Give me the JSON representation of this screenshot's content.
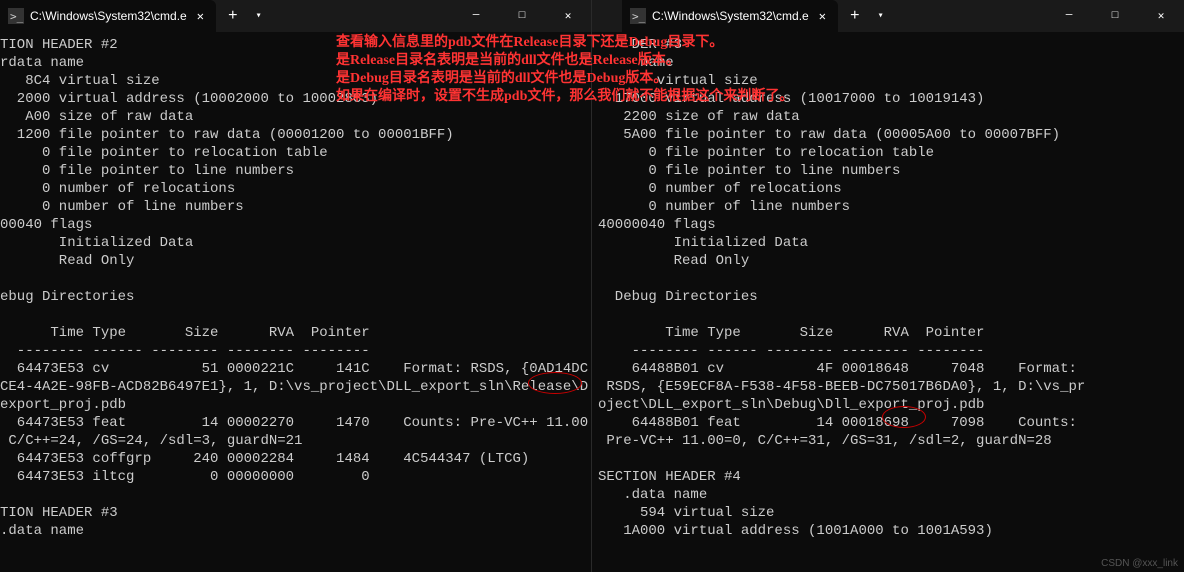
{
  "left": {
    "tab_title": "C:\\Windows\\System32\\cmd.e",
    "terminal": "TION HEADER #2\nrdata name\n   8C4 virtual size\n  2000 virtual address (10002000 to 100028C3)\n   A00 size of raw data\n  1200 file pointer to raw data (00001200 to 00001BFF)\n     0 file pointer to relocation table\n     0 file pointer to line numbers\n     0 number of relocations\n     0 number of line numbers\n00040 flags\n       Initialized Data\n       Read Only\n\nebug Directories\n\n      Time Type       Size      RVA  Pointer\n  -------- ------ -------- -------- --------\n  64473E53 cv           51 0000221C     141C    Format: RSDS, {0AD14DC\nCE4-4A2E-98FB-ACD82B6497E1}, 1, D:\\vs_project\\DLL_export_sln\\Release\\D\nexport_proj.pdb\n  64473E53 feat         14 00002270     1470    Counts: Pre-VC++ 11.00\n C/C++=24, /GS=24, /sdl=3, guardN=21\n  64473E53 coffgrp     240 00002284     1484    4C544347 (LTCG)\n  64473E53 iltcg         0 00000000        0\n\nTION HEADER #3\n.data name"
  },
  "right": {
    "tab_title": "C:\\Windows\\System32\\cmd.e",
    "terminal": "    DER #3\n     name\n       virtual size\n  17000 virtual address (10017000 to 10019143)\n   2200 size of raw data\n   5A00 file pointer to raw data (00005A00 to 00007BFF)\n      0 file pointer to relocation table\n      0 file pointer to line numbers\n      0 number of relocations\n      0 number of line numbers\n40000040 flags\n         Initialized Data\n         Read Only\n\n  Debug Directories\n\n        Time Type       Size      RVA  Pointer\n    -------- ------ -------- -------- --------\n    64488B01 cv           4F 00018648     7048    Format:\n RSDS, {E59ECF8A-F538-4F58-BEEB-DC75017B6DA0}, 1, D:\\vs_pr\noject\\DLL_export_sln\\Debug\\Dll_export_proj.pdb\n    64488B01 feat         14 00018698     7098    Counts:\n Pre-VC++ 11.00=0, C/C++=31, /GS=31, /sdl=2, guardN=28\n\nSECTION HEADER #4\n   .data name\n     594 virtual size\n   1A000 virtual address (1001A000 to 1001A593)"
  },
  "annotations": {
    "line1": "查看输入信息里的pdb文件在Release目录下还是Debug目录下。",
    "line2": "是Release目录名表明是当前的dll文件也是Release版本。",
    "line3": "是Debug目录名表明是当前的dll文件也是Debug版本。",
    "line4": "如果在编译时，设置不生成pdb文件，那么我们就不能根据这个来判断了。"
  },
  "win_controls": {
    "min": "─",
    "max": "□",
    "close": "✕"
  },
  "new_tab": "+",
  "dropdown": "▾",
  "tab_close": "✕",
  "watermark": "CSDN @xxx_link"
}
